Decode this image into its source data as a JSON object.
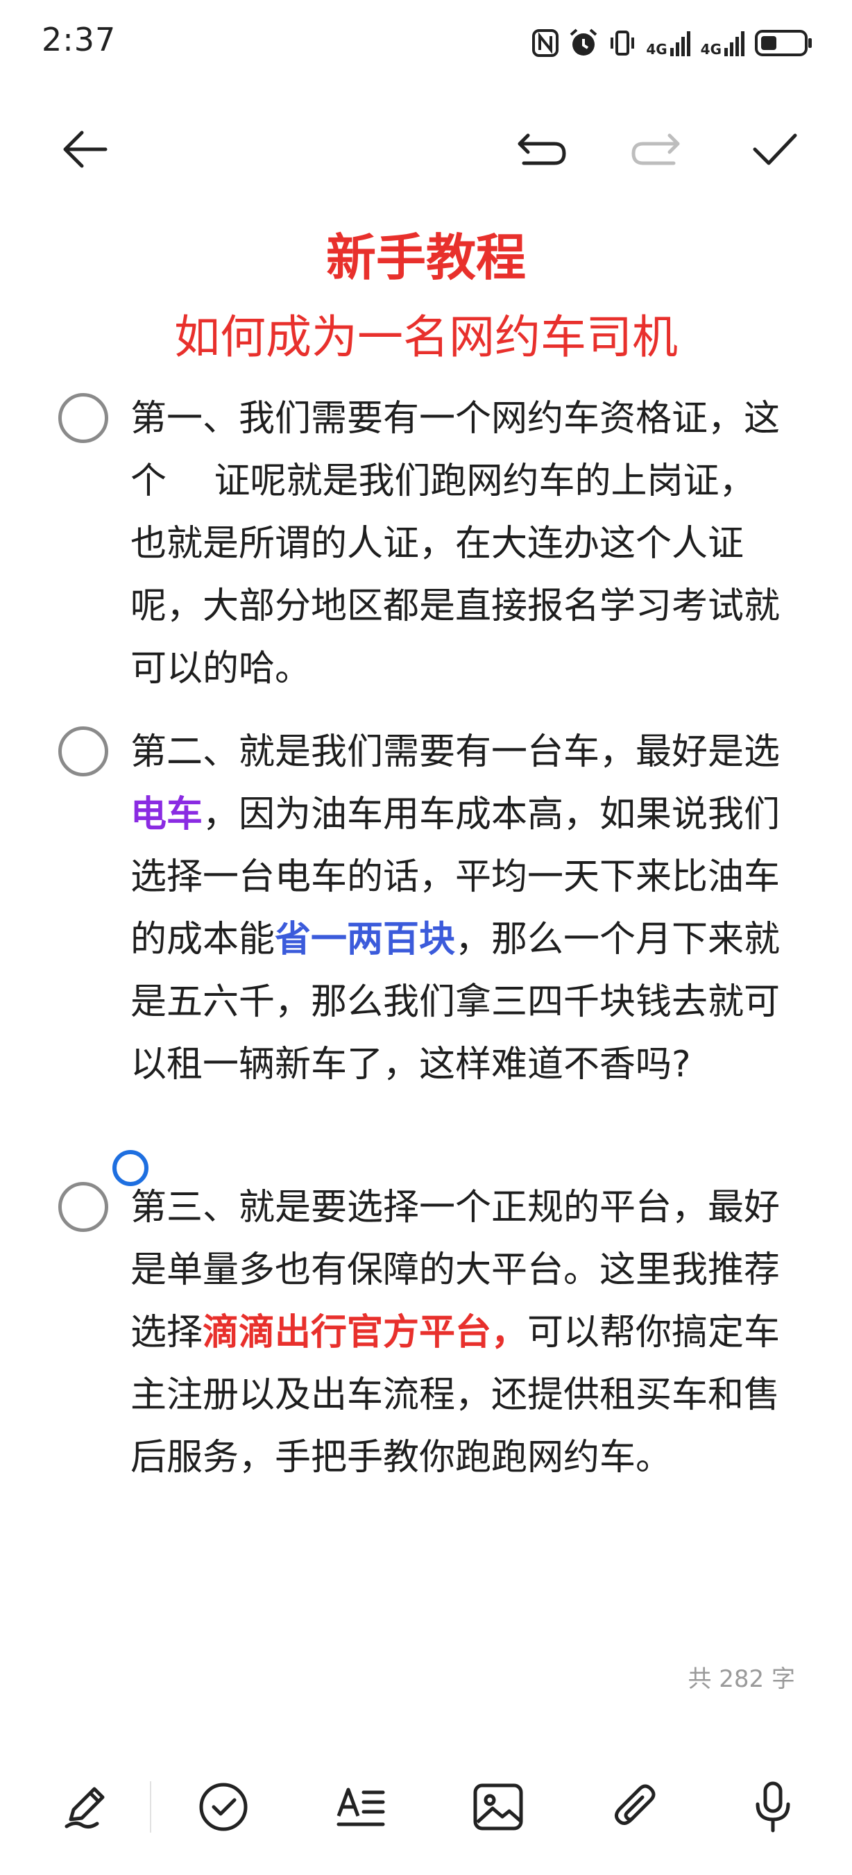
{
  "status_bar": {
    "time": "2:37",
    "icons": [
      "nfc-icon",
      "alarm-icon",
      "vibrate-icon",
      "signal-4g-icon",
      "signal-4g-icon",
      "battery-icon"
    ],
    "signal_label_1": "4G",
    "signal_label_2": "4G"
  },
  "toolbar": {
    "back_icon": "arrow-left-icon",
    "undo_icon": "undo-icon",
    "redo_icon": "redo-icon",
    "done_icon": "checkmark-icon"
  },
  "note": {
    "title": "新手教程",
    "subtitle": "如何成为一名网约车司机",
    "items": [
      {
        "text": "第一、我们需要有一个网约车资格证，这个　 证呢就是我们跑网约车的上岗证，也就是所谓的人证，在大连办这个人证呢，大部分地区都是直接报名学习考试就可以的哈。"
      },
      {
        "p1": "第二、就是我们需要有一台车，最好是选",
        "h1": "电车",
        "p2": "，因为油车用车成本高，如果说我们选择一台电车的话，平均一天下来比油车的成本能",
        "h2": "省一两百块",
        "p3": "，那么一个月下来就是五六千，那么我们拿三四千块钱去就可以租一辆新车了，这样难道不香吗?"
      },
      {
        "p1": "第三、就是要选择一个正规的平台，最好是单量多也有保障的大平台。这里我推荐选择",
        "h1": "滴滴出行官方平台，",
        "p2": "可以帮你搞定车主注册以及出车流程，还提供租买车和售后服务，手把手教你跑跑网约车。"
      }
    ],
    "word_count": "共 282 字"
  },
  "colors": {
    "title_red": "#e8302c",
    "highlight_purple": "#8a2be2",
    "highlight_blue": "#3b5bdb",
    "cursor_blue": "#1e6fe0"
  },
  "bottom_bar": {
    "icons": [
      "pen-icon",
      "checklist-icon",
      "text-format-icon",
      "image-icon",
      "attachment-icon",
      "microphone-icon"
    ]
  }
}
